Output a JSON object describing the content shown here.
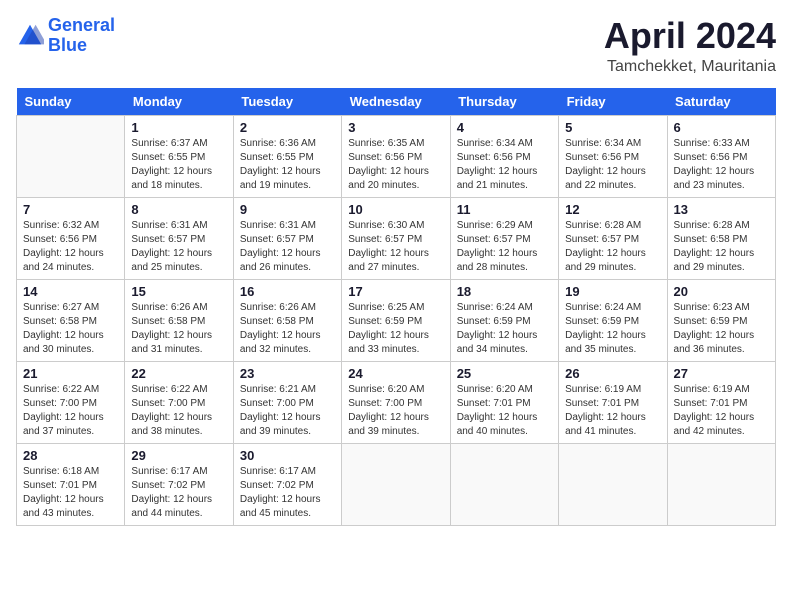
{
  "header": {
    "logo_line1": "General",
    "logo_line2": "Blue",
    "month": "April 2024",
    "location": "Tamchekket, Mauritania"
  },
  "days_of_week": [
    "Sunday",
    "Monday",
    "Tuesday",
    "Wednesday",
    "Thursday",
    "Friday",
    "Saturday"
  ],
  "weeks": [
    [
      {
        "day": "",
        "info": ""
      },
      {
        "day": "1",
        "info": "Sunrise: 6:37 AM\nSunset: 6:55 PM\nDaylight: 12 hours\nand 18 minutes."
      },
      {
        "day": "2",
        "info": "Sunrise: 6:36 AM\nSunset: 6:55 PM\nDaylight: 12 hours\nand 19 minutes."
      },
      {
        "day": "3",
        "info": "Sunrise: 6:35 AM\nSunset: 6:56 PM\nDaylight: 12 hours\nand 20 minutes."
      },
      {
        "day": "4",
        "info": "Sunrise: 6:34 AM\nSunset: 6:56 PM\nDaylight: 12 hours\nand 21 minutes."
      },
      {
        "day": "5",
        "info": "Sunrise: 6:34 AM\nSunset: 6:56 PM\nDaylight: 12 hours\nand 22 minutes."
      },
      {
        "day": "6",
        "info": "Sunrise: 6:33 AM\nSunset: 6:56 PM\nDaylight: 12 hours\nand 23 minutes."
      }
    ],
    [
      {
        "day": "7",
        "info": "Sunrise: 6:32 AM\nSunset: 6:56 PM\nDaylight: 12 hours\nand 24 minutes."
      },
      {
        "day": "8",
        "info": "Sunrise: 6:31 AM\nSunset: 6:57 PM\nDaylight: 12 hours\nand 25 minutes."
      },
      {
        "day": "9",
        "info": "Sunrise: 6:31 AM\nSunset: 6:57 PM\nDaylight: 12 hours\nand 26 minutes."
      },
      {
        "day": "10",
        "info": "Sunrise: 6:30 AM\nSunset: 6:57 PM\nDaylight: 12 hours\nand 27 minutes."
      },
      {
        "day": "11",
        "info": "Sunrise: 6:29 AM\nSunset: 6:57 PM\nDaylight: 12 hours\nand 28 minutes."
      },
      {
        "day": "12",
        "info": "Sunrise: 6:28 AM\nSunset: 6:57 PM\nDaylight: 12 hours\nand 29 minutes."
      },
      {
        "day": "13",
        "info": "Sunrise: 6:28 AM\nSunset: 6:58 PM\nDaylight: 12 hours\nand 29 minutes."
      }
    ],
    [
      {
        "day": "14",
        "info": "Sunrise: 6:27 AM\nSunset: 6:58 PM\nDaylight: 12 hours\nand 30 minutes."
      },
      {
        "day": "15",
        "info": "Sunrise: 6:26 AM\nSunset: 6:58 PM\nDaylight: 12 hours\nand 31 minutes."
      },
      {
        "day": "16",
        "info": "Sunrise: 6:26 AM\nSunset: 6:58 PM\nDaylight: 12 hours\nand 32 minutes."
      },
      {
        "day": "17",
        "info": "Sunrise: 6:25 AM\nSunset: 6:59 PM\nDaylight: 12 hours\nand 33 minutes."
      },
      {
        "day": "18",
        "info": "Sunrise: 6:24 AM\nSunset: 6:59 PM\nDaylight: 12 hours\nand 34 minutes."
      },
      {
        "day": "19",
        "info": "Sunrise: 6:24 AM\nSunset: 6:59 PM\nDaylight: 12 hours\nand 35 minutes."
      },
      {
        "day": "20",
        "info": "Sunrise: 6:23 AM\nSunset: 6:59 PM\nDaylight: 12 hours\nand 36 minutes."
      }
    ],
    [
      {
        "day": "21",
        "info": "Sunrise: 6:22 AM\nSunset: 7:00 PM\nDaylight: 12 hours\nand 37 minutes."
      },
      {
        "day": "22",
        "info": "Sunrise: 6:22 AM\nSunset: 7:00 PM\nDaylight: 12 hours\nand 38 minutes."
      },
      {
        "day": "23",
        "info": "Sunrise: 6:21 AM\nSunset: 7:00 PM\nDaylight: 12 hours\nand 39 minutes."
      },
      {
        "day": "24",
        "info": "Sunrise: 6:20 AM\nSunset: 7:00 PM\nDaylight: 12 hours\nand 39 minutes."
      },
      {
        "day": "25",
        "info": "Sunrise: 6:20 AM\nSunset: 7:01 PM\nDaylight: 12 hours\nand 40 minutes."
      },
      {
        "day": "26",
        "info": "Sunrise: 6:19 AM\nSunset: 7:01 PM\nDaylight: 12 hours\nand 41 minutes."
      },
      {
        "day": "27",
        "info": "Sunrise: 6:19 AM\nSunset: 7:01 PM\nDaylight: 12 hours\nand 42 minutes."
      }
    ],
    [
      {
        "day": "28",
        "info": "Sunrise: 6:18 AM\nSunset: 7:01 PM\nDaylight: 12 hours\nand 43 minutes."
      },
      {
        "day": "29",
        "info": "Sunrise: 6:17 AM\nSunset: 7:02 PM\nDaylight: 12 hours\nand 44 minutes."
      },
      {
        "day": "30",
        "info": "Sunrise: 6:17 AM\nSunset: 7:02 PM\nDaylight: 12 hours\nand 45 minutes."
      },
      {
        "day": "",
        "info": ""
      },
      {
        "day": "",
        "info": ""
      },
      {
        "day": "",
        "info": ""
      },
      {
        "day": "",
        "info": ""
      }
    ]
  ]
}
